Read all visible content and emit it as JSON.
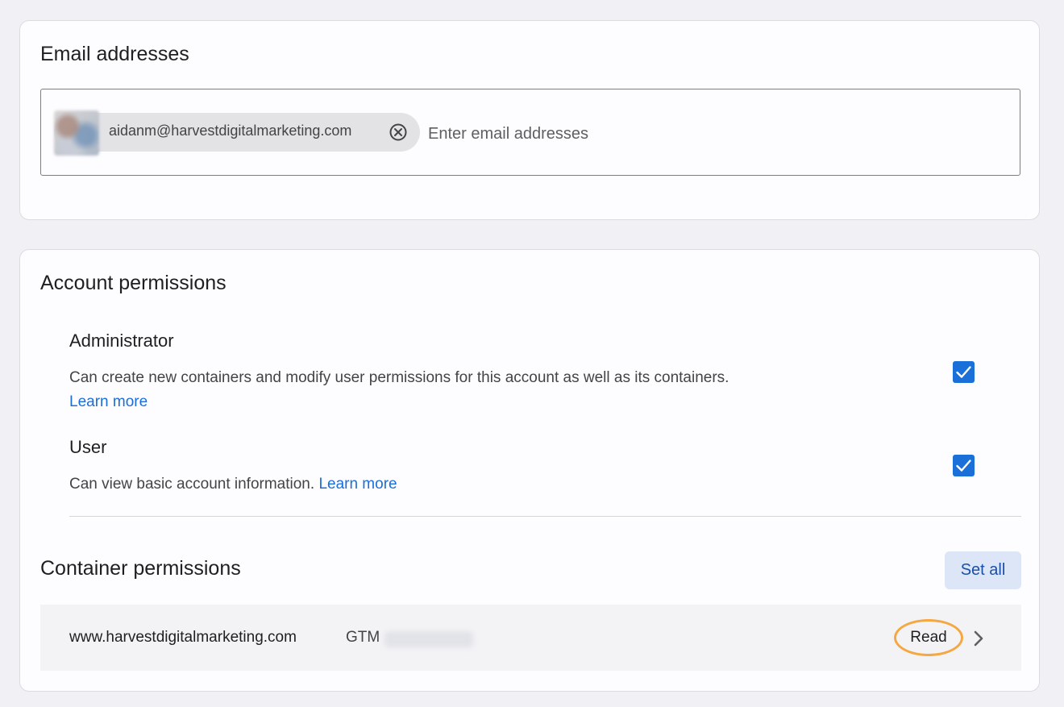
{
  "email_section": {
    "title": "Email addresses",
    "chips": [
      {
        "email": "aidanm@harvestdigitalmarketing.com",
        "remove_icon": "close-circle-icon"
      }
    ],
    "input_placeholder": "Enter email addresses"
  },
  "account_permissions": {
    "title": "Account permissions",
    "items": [
      {
        "name": "Administrator",
        "description": "Can create new containers and modify user permissions for this account as well as its containers.",
        "link": "Learn more",
        "checked": true
      },
      {
        "name": "User",
        "description": "Can view basic account information.",
        "link": "Learn more",
        "checked": true
      }
    ]
  },
  "container_permissions": {
    "title": "Container permissions",
    "set_all_label": "Set all",
    "rows": [
      {
        "domain": "www.harvestdigitalmarketing.com",
        "gtm_prefix": "GTM",
        "role": "Read",
        "chevron_icon": "chevron-right-icon"
      }
    ]
  },
  "colors": {
    "accent": "#1a6fd8",
    "highlight_ring": "#f5a742",
    "set_all_bg": "#dce6f6"
  }
}
